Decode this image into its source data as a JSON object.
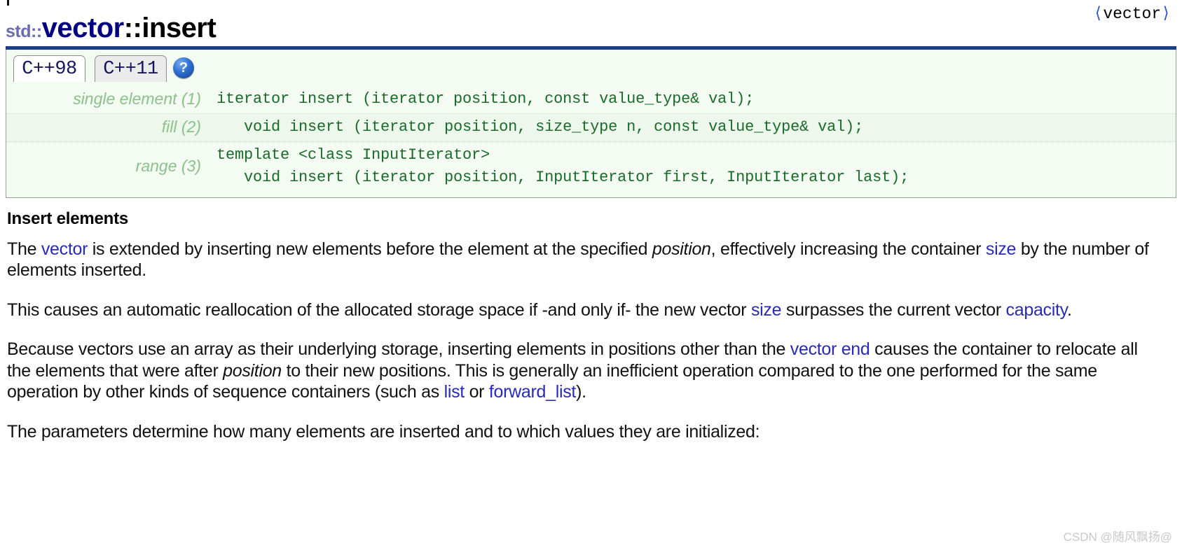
{
  "header": {
    "namespace": "std::",
    "class_name": "vector",
    "separator": "::",
    "member": "insert",
    "include_open": "⟨",
    "include_name": "vector",
    "include_close": "⟩"
  },
  "tabs": [
    {
      "label": "C++98",
      "active": true
    },
    {
      "label": "C++11",
      "active": false
    }
  ],
  "help": {
    "icon": "question-mark-icon",
    "glyph": "?"
  },
  "signatures": [
    {
      "label": "single element (1)",
      "code": "iterator insert (iterator position, const value_type& val);"
    },
    {
      "label": "fill (2)",
      "code": "   void insert (iterator position, size_type n, const value_type& val);"
    },
    {
      "label": "range (3)",
      "code": "template <class InputIterator>\n   void insert (iterator position, InputIterator first, InputIterator last);"
    }
  ],
  "section": {
    "title": "Insert elements"
  },
  "paragraphs": [
    {
      "id": "p1",
      "parts": [
        {
          "t": "The ",
          "k": "text"
        },
        {
          "t": "vector",
          "k": "link"
        },
        {
          "t": " is extended by inserting new elements before the element at the specified ",
          "k": "text"
        },
        {
          "t": "position",
          "k": "italic"
        },
        {
          "t": ", effectively increasing the container ",
          "k": "text"
        },
        {
          "t": "size",
          "k": "link"
        },
        {
          "t": " by the number of elements inserted.",
          "k": "text"
        }
      ]
    },
    {
      "id": "p2",
      "parts": [
        {
          "t": "This causes an automatic reallocation of the allocated storage space if -and only if- the new vector ",
          "k": "text"
        },
        {
          "t": "size",
          "k": "link"
        },
        {
          "t": " surpasses the current vector ",
          "k": "text"
        },
        {
          "t": "capacity",
          "k": "link"
        },
        {
          "t": ".",
          "k": "text"
        }
      ]
    },
    {
      "id": "p3",
      "parts": [
        {
          "t": "Because vectors use an array as their underlying storage, inserting elements in positions other than the ",
          "k": "text"
        },
        {
          "t": "vector end",
          "k": "link"
        },
        {
          "t": " causes the container to relocate all the elements that were after ",
          "k": "text"
        },
        {
          "t": "position",
          "k": "italic"
        },
        {
          "t": " to their new positions. This is generally an inefficient operation compared to the one performed for the same operation by other kinds of sequence containers (such as ",
          "k": "text"
        },
        {
          "t": "list",
          "k": "link"
        },
        {
          "t": " or ",
          "k": "text"
        },
        {
          "t": "forward_list",
          "k": "link"
        },
        {
          "t": ").",
          "k": "text"
        }
      ]
    },
    {
      "id": "p4",
      "parts": [
        {
          "t": "The parameters determine how many elements are inserted and to which values they are initialized:",
          "k": "text"
        }
      ]
    }
  ],
  "watermark": {
    "text": "CSDN @随风飘扬@"
  },
  "colors": {
    "title_class": "#000080",
    "title_namespace": "#6b6bb0",
    "rule": "#1b3f86",
    "link": "#2a2ab8",
    "code_green": "#1a6b2a",
    "label_green": "#8cc18a",
    "panel_bg": "#f4fbf2",
    "help_blue": "#2f6fd0"
  }
}
